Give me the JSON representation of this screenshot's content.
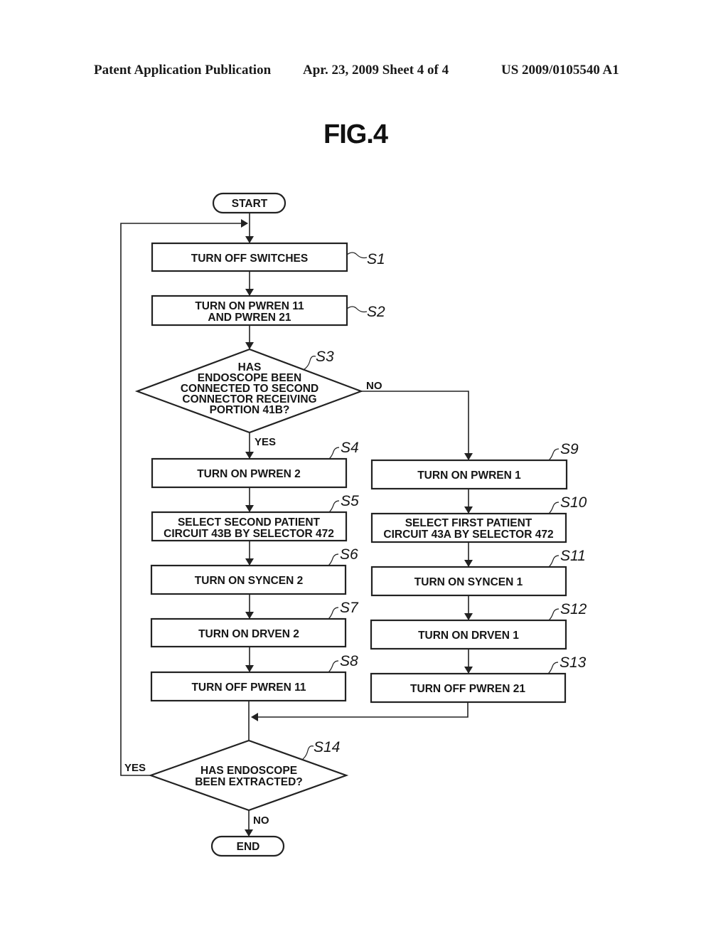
{
  "header": {
    "left": "Patent Application Publication",
    "middle": "Apr. 23, 2009  Sheet 4 of 4",
    "right": "US 2009/0105540 A1"
  },
  "figure": {
    "title": "FIG.4"
  },
  "flowchart": {
    "start": "START",
    "end": "END",
    "steps": {
      "s1": {
        "label": "S1",
        "lines": [
          "TURN OFF SWITCHES"
        ]
      },
      "s2": {
        "label": "S2",
        "lines": [
          "TURN ON PWREN 11",
          "AND PWREN 21"
        ]
      },
      "s3": {
        "label": "S3",
        "lines": [
          "HAS",
          "ENDOSCOPE BEEN",
          "CONNECTED TO SECOND",
          "CONNECTOR RECEIVING",
          "PORTION 41B?"
        ]
      },
      "s4": {
        "label": "S4",
        "lines": [
          "TURN ON PWREN 2"
        ]
      },
      "s5": {
        "label": "S5",
        "lines": [
          "SELECT SECOND PATIENT",
          "CIRCUIT 43B BY SELECTOR 472"
        ]
      },
      "s6": {
        "label": "S6",
        "lines": [
          "TURN ON SYNCEN 2"
        ]
      },
      "s7": {
        "label": "S7",
        "lines": [
          "TURN ON DRVEN 2"
        ]
      },
      "s8": {
        "label": "S8",
        "lines": [
          "TURN OFF PWREN 11"
        ]
      },
      "s9": {
        "label": "S9",
        "lines": [
          "TURN ON PWREN 1"
        ]
      },
      "s10": {
        "label": "S10",
        "lines": [
          "SELECT FIRST PATIENT",
          "CIRCUIT 43A BY SELECTOR 472"
        ]
      },
      "s11": {
        "label": "S11",
        "lines": [
          "TURN ON SYNCEN 1"
        ]
      },
      "s12": {
        "label": "S12",
        "lines": [
          "TURN ON DRVEN 1"
        ]
      },
      "s13": {
        "label": "S13",
        "lines": [
          "TURN OFF PWREN 21"
        ]
      },
      "s14": {
        "label": "S14",
        "lines": [
          "HAS ENDOSCOPE",
          "BEEN EXTRACTED?"
        ]
      }
    },
    "branch_labels": {
      "s3_yes": "YES",
      "s3_no": "NO",
      "s14_yes": "YES",
      "s14_no": "NO"
    }
  }
}
